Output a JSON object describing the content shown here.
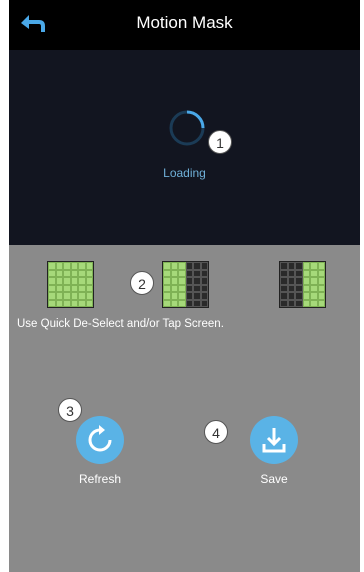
{
  "header": {
    "title": "Motion Mask"
  },
  "preview": {
    "loading_text": "Loading"
  },
  "badges": {
    "b1": "1",
    "b2": "2",
    "b3": "3",
    "b4": "4"
  },
  "panel": {
    "hint": "Use Quick De-Select and/or Tap Screen."
  },
  "actions": {
    "refresh_label": "Refresh",
    "save_label": "Save"
  },
  "colors": {
    "accent": "#5ab3e6",
    "grid_on": "#a6d97a",
    "panel_bg": "#8a8a8a"
  },
  "icons": {
    "back": "back-arrow-icon",
    "refresh": "refresh-icon",
    "save": "download-icon"
  }
}
